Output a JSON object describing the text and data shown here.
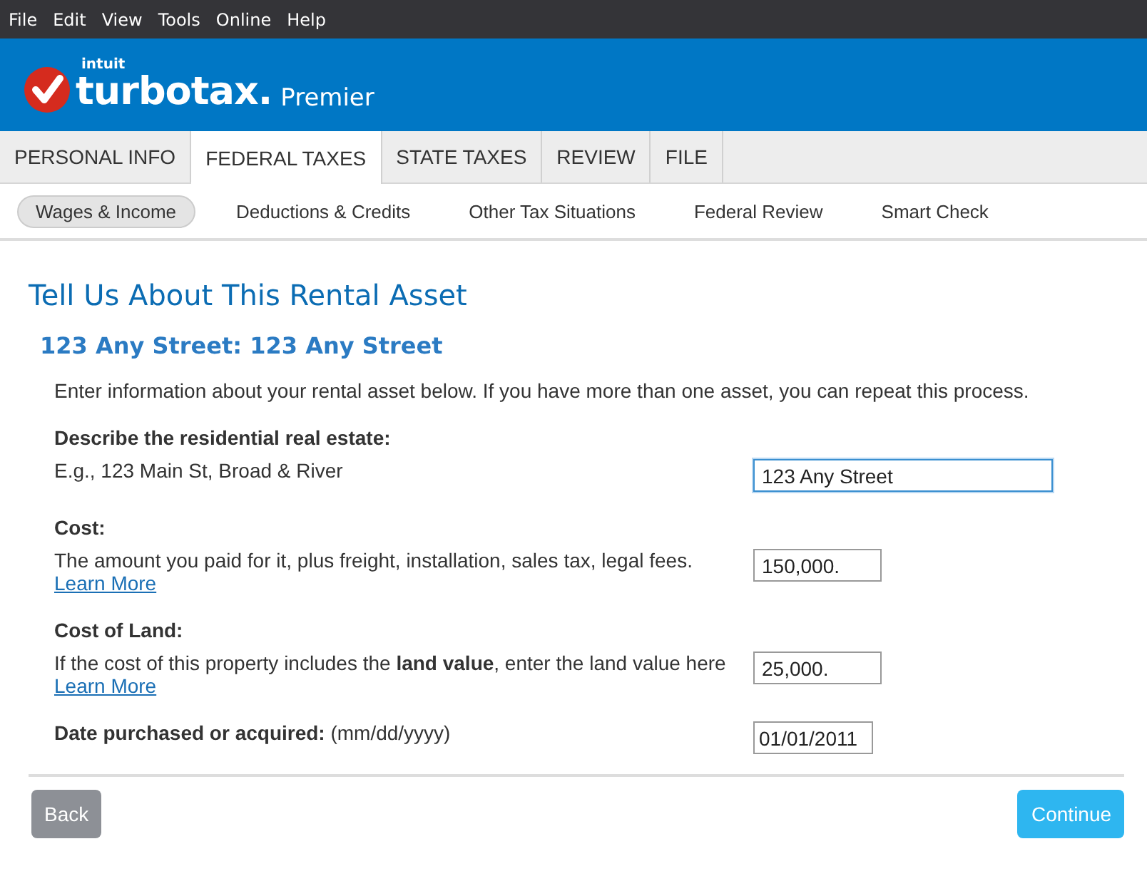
{
  "menu_bar": [
    "File",
    "Edit",
    "View",
    "Tools",
    "Online",
    "Help"
  ],
  "header": {
    "brand_small": "intuit",
    "brand": "turbotax.",
    "edition": "Premier"
  },
  "tabs": [
    {
      "label": "PERSONAL INFO",
      "selected": false
    },
    {
      "label": "FEDERAL TAXES",
      "selected": true
    },
    {
      "label": "STATE TAXES",
      "selected": false
    },
    {
      "label": "REVIEW",
      "selected": false
    },
    {
      "label": "FILE",
      "selected": false
    }
  ],
  "subnav": [
    {
      "label": "Wages & Income",
      "selected": true
    },
    {
      "label": "Deductions & Credits",
      "selected": false
    },
    {
      "label": "Other Tax Situations",
      "selected": false
    },
    {
      "label": "Federal Review",
      "selected": false
    },
    {
      "label": "Smart Check",
      "selected": false
    }
  ],
  "page_title": "Tell Us About This Rental Asset",
  "subtitle": "123 Any Street: 123 Any Street",
  "intro": "Enter information about your rental asset below. If you have more than one asset, you can repeat this process.",
  "fields": [
    {
      "heading": "Describe the residential real estate:",
      "description": "E.g., 123 Main St, Broad & River",
      "value": "123 Any Street",
      "kind": "wide",
      "focused": true
    },
    {
      "heading": "Cost:",
      "description": "The amount you paid for it, plus freight, installation, sales tax, legal fees.",
      "link": "Learn More",
      "value": "150,000.",
      "kind": "medium",
      "focused": false
    },
    {
      "heading": "Cost of Land:",
      "description": "If the cost of this property includes the **land value**, enter the land value here",
      "link": "Learn More",
      "value": "25,000.",
      "kind": "medium",
      "focused": false
    },
    {
      "inline_label": "**Date purchased or acquired:** (mm/dd/yyyy)",
      "value": "01/01/2011",
      "kind": "small",
      "focused": false
    }
  ],
  "buttons": [
    {
      "label": "Back",
      "kind": "secondary"
    },
    {
      "label": "Continue",
      "kind": "primary"
    }
  ]
}
